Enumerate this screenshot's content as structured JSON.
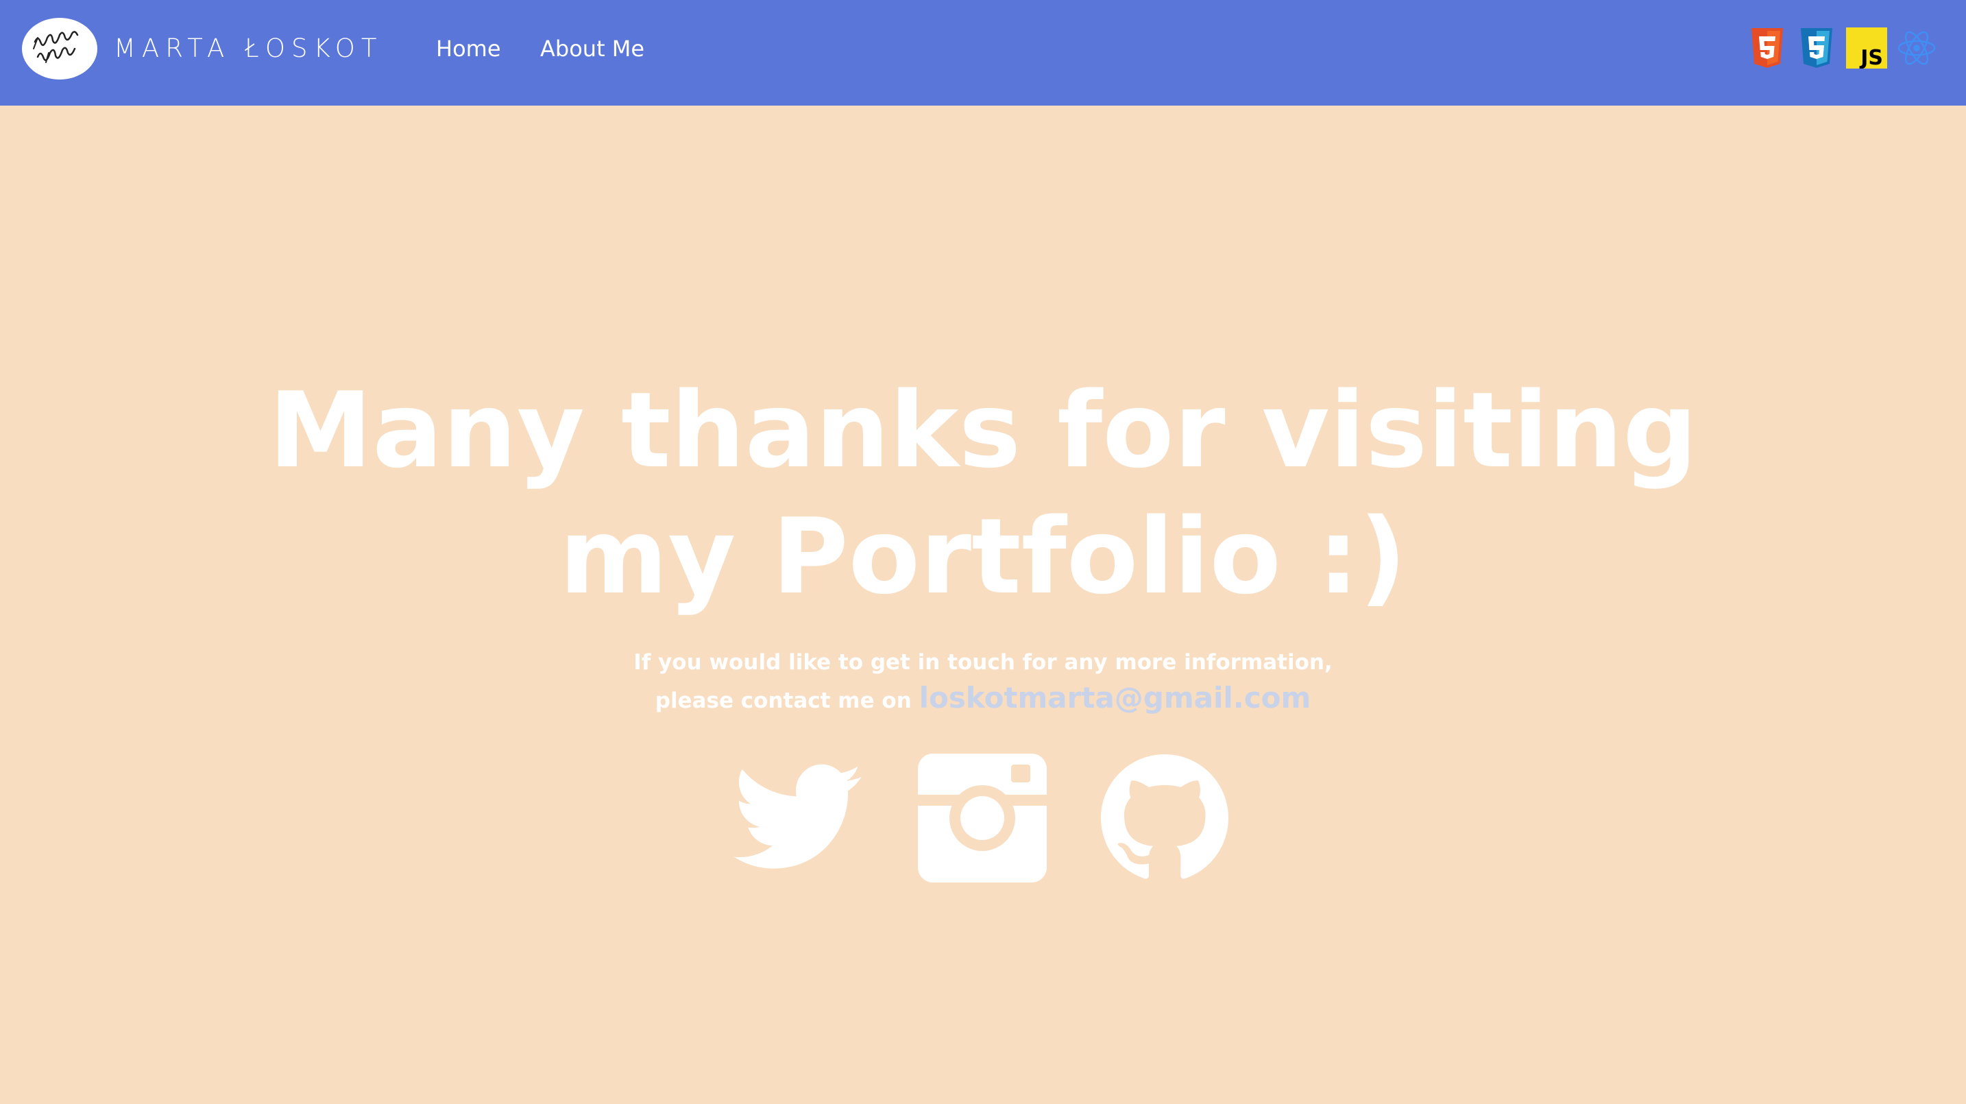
{
  "brand": {
    "name": "MARTA ŁOSKOT",
    "logo_icon": "handwritten-logo-icon"
  },
  "nav": {
    "items": [
      {
        "label": "Home"
      },
      {
        "label": "About Me"
      }
    ]
  },
  "tech_icons": [
    {
      "name": "html5-icon",
      "color": "#e44d26"
    },
    {
      "name": "css3-icon",
      "color": "#2965f1"
    },
    {
      "name": "javascript-icon",
      "color": "#f7df1e",
      "text": "JS"
    },
    {
      "name": "react-icon",
      "color": "#61dafb"
    }
  ],
  "main": {
    "headline_line1": "Many thanks for visiting",
    "headline_line2": "my Portfolio :)",
    "contact_line1": "If you would like to get in touch for any more information,",
    "contact_line2": "please contact me on",
    "email": "loskotmarta@gmail.com"
  },
  "social": [
    {
      "name": "twitter-icon"
    },
    {
      "name": "instagram-icon"
    },
    {
      "name": "github-icon"
    }
  ],
  "colors": {
    "navbar": "#5b76d9",
    "background": "#f8ddc1",
    "text": "#ffffff",
    "email": "#c8d2e8"
  }
}
